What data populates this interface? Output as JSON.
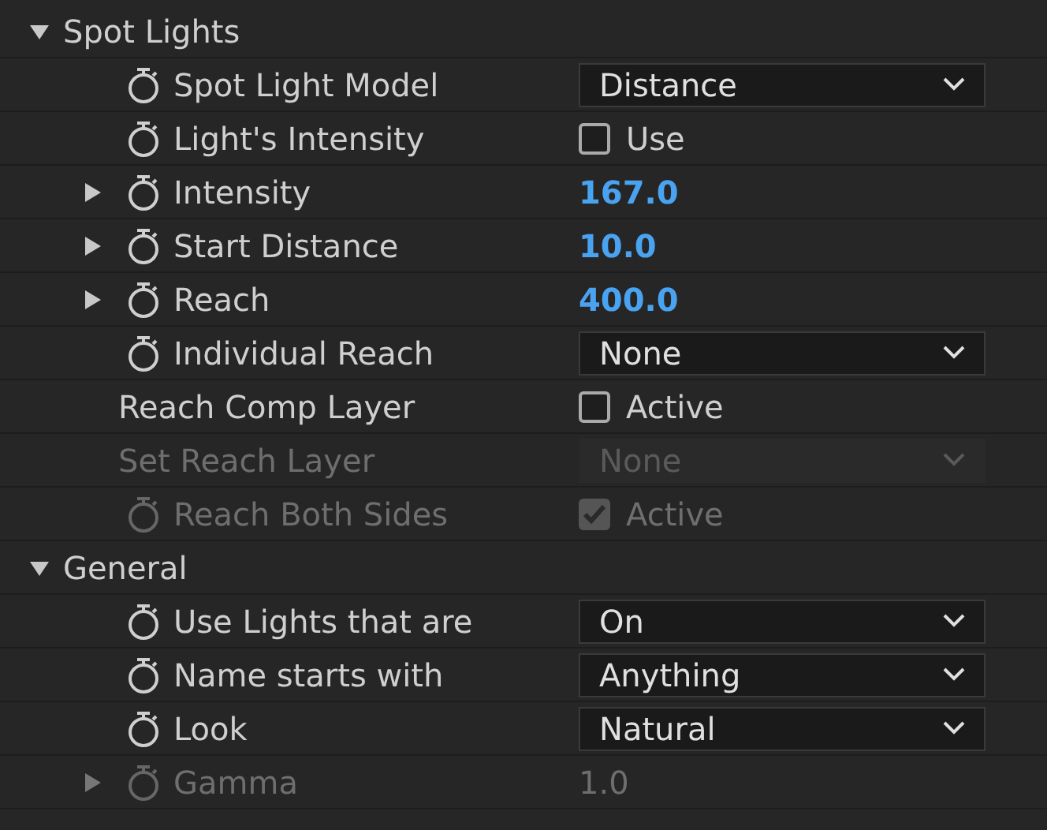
{
  "sections": [
    {
      "label": "Spot Lights",
      "expanded": true,
      "rows": [
        {
          "kind": "dropdown",
          "label": "Spot Light Model",
          "stopwatch": true,
          "disabled": false,
          "value": "Distance"
        },
        {
          "kind": "checkbox",
          "label": "Light's Intensity",
          "stopwatch": true,
          "disabled": false,
          "checked": false,
          "value": "Use"
        },
        {
          "kind": "number",
          "label": "Intensity",
          "stopwatch": true,
          "disabled": false,
          "expanded": false,
          "value": "167.0"
        },
        {
          "kind": "number",
          "label": "Start Distance",
          "stopwatch": true,
          "disabled": false,
          "expanded": false,
          "value": "10.0"
        },
        {
          "kind": "number",
          "label": "Reach",
          "stopwatch": true,
          "disabled": false,
          "expanded": false,
          "value": "400.0"
        },
        {
          "kind": "dropdown",
          "label": "Individual Reach",
          "stopwatch": true,
          "disabled": false,
          "value": "None"
        },
        {
          "kind": "checkbox",
          "label": "Reach Comp Layer",
          "stopwatch": false,
          "disabled": false,
          "checked": false,
          "value": "Active"
        },
        {
          "kind": "dropdown",
          "label": "Set Reach Layer",
          "stopwatch": false,
          "disabled": true,
          "value": "None"
        },
        {
          "kind": "checkbox",
          "label": "Reach Both Sides",
          "stopwatch": true,
          "disabled": true,
          "checked": true,
          "value": "Active"
        }
      ]
    },
    {
      "label": "General",
      "expanded": true,
      "rows": [
        {
          "kind": "dropdown",
          "label": "Use Lights that are",
          "stopwatch": true,
          "disabled": false,
          "value": "On"
        },
        {
          "kind": "dropdown",
          "label": "Name starts with",
          "stopwatch": true,
          "disabled": false,
          "value": "Anything"
        },
        {
          "kind": "dropdown",
          "label": "Look",
          "stopwatch": true,
          "disabled": false,
          "value": "Natural"
        },
        {
          "kind": "number",
          "label": "Gamma",
          "stopwatch": true,
          "disabled": true,
          "expanded": false,
          "value": "1.0"
        }
      ]
    }
  ]
}
